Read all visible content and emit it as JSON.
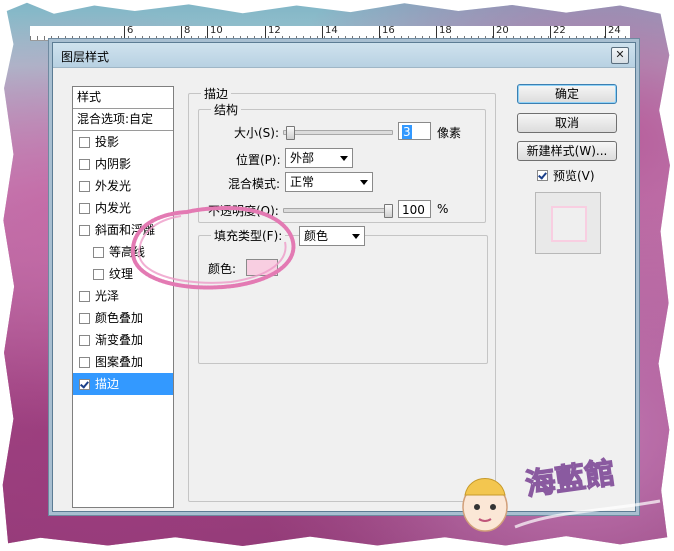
{
  "ruler": {
    "ticks": [
      "6",
      "8",
      "10",
      "12",
      "14",
      "16",
      "18",
      "20",
      "22",
      "24"
    ]
  },
  "dialog": {
    "title": "图层样式",
    "close_glyph": "✕"
  },
  "style_list": {
    "header": "样式",
    "blend_options": "混合选项:自定",
    "items": [
      {
        "label": "投影",
        "checked": false,
        "sub": false
      },
      {
        "label": "内阴影",
        "checked": false,
        "sub": false
      },
      {
        "label": "外发光",
        "checked": false,
        "sub": false
      },
      {
        "label": "内发光",
        "checked": false,
        "sub": false
      },
      {
        "label": "斜面和浮雕",
        "checked": false,
        "sub": false
      },
      {
        "label": "等高线",
        "checked": false,
        "sub": true
      },
      {
        "label": "纹理",
        "checked": false,
        "sub": true
      },
      {
        "label": "光泽",
        "checked": false,
        "sub": false
      },
      {
        "label": "颜色叠加",
        "checked": false,
        "sub": false
      },
      {
        "label": "渐变叠加",
        "checked": false,
        "sub": false
      },
      {
        "label": "图案叠加",
        "checked": false,
        "sub": false
      },
      {
        "label": "描边",
        "checked": true,
        "sub": false,
        "selected": true
      }
    ]
  },
  "stroke": {
    "group_title": "描边",
    "structure_title": "结构",
    "size_label": "大小(S):",
    "size_value": "3",
    "size_unit": "像素",
    "position_label": "位置(P):",
    "position_value": "外部",
    "blend_label": "混合模式:",
    "blend_value": "正常",
    "opacity_label": "不透明度(O):",
    "opacity_value": "100",
    "opacity_unit": "%",
    "fill_type_label": "填充类型(F):",
    "fill_type_value": "颜色",
    "color_label": "颜色:",
    "stroke_color": "#f8cee1",
    "size_slider_level": 0.02,
    "opacity_slider_level": 1.0
  },
  "buttons": {
    "ok": "确定",
    "cancel": "取消",
    "new_style": "新建样式(W)...",
    "preview_label": "预览(V)",
    "preview_checked": true
  },
  "watermark": {
    "text": "海藍館"
  },
  "colors": {
    "selection": "#3399ff",
    "annotation": "#e37ab3"
  }
}
